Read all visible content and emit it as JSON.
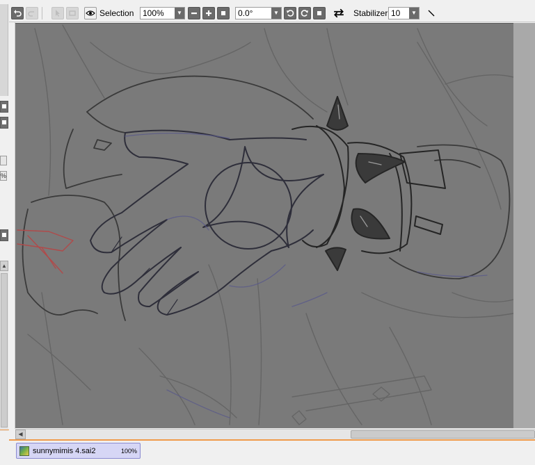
{
  "toolbar": {
    "undo_icon": "undo-icon",
    "redo_icon": "redo-icon",
    "selection_label": "Selection",
    "zoom_value": "100%",
    "rotation_value": "0.0°",
    "stabilizer_label": "Stabilizer",
    "stabilizer_value": "10",
    "icons": {
      "view": "eye-icon",
      "zoom_out": "minus-icon",
      "zoom_in": "plus-icon",
      "zoom_reset": "square-icon",
      "rotate_ccw": "rotate-ccw-icon",
      "rotate_cw": "rotate-cw-icon",
      "rotate_reset": "square-icon",
      "flip": "flip-horizontal-icon",
      "line": "diagonal-line-icon"
    }
  },
  "left_panel": {
    "mini_labels": [
      "",
      "%"
    ]
  },
  "canvas": {
    "background": "#7a7a7a",
    "margin_color": "#a9a9a9"
  },
  "document_tab": {
    "name": "sunnymimis 4.sai2",
    "zoom": "100%"
  },
  "colors": {
    "accent_orange": "#f09a4a",
    "tab_bg": "#d6d6f5",
    "tab_border": "#8a8ad0"
  }
}
